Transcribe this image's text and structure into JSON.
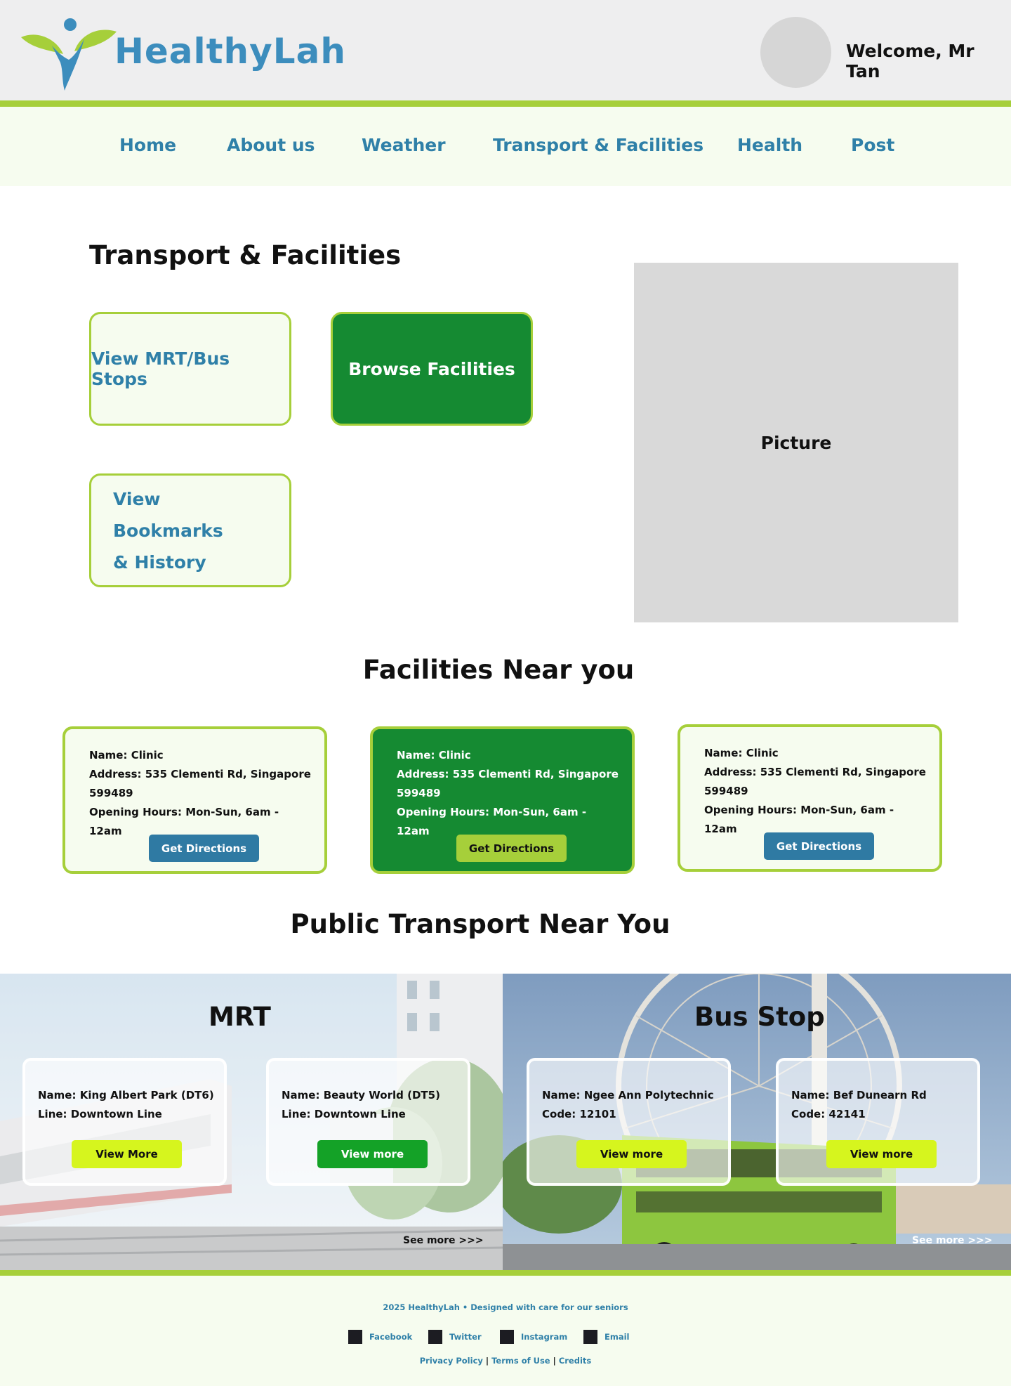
{
  "header": {
    "brand": "HealthyLah",
    "welcome": "Welcome, Mr Tan"
  },
  "nav": {
    "items": [
      {
        "label": "Home"
      },
      {
        "label": "About us"
      },
      {
        "label": "Weather"
      },
      {
        "label": "Transport & Facilities"
      },
      {
        "label": "Health"
      },
      {
        "label": "Post"
      }
    ]
  },
  "main": {
    "title": "Transport & Facilities",
    "buttons": {
      "mrt_bus": "View MRT/Bus Stops",
      "browse": "Browse Facilities",
      "bookmarks_line1": "View Bookmarks",
      "bookmarks_line2": "& History"
    },
    "picture_label": "Picture"
  },
  "facilities": {
    "title": "Facilities Near you",
    "cards": [
      {
        "name": "Name: Clinic",
        "address_line1": "Address: 535 Clementi Rd, Singapore",
        "address_line2": "599489",
        "hours": "Opening Hours: Mon-Sun, 6am - 12am",
        "button": "Get Directions"
      },
      {
        "name": "Name: Clinic",
        "address_line1": "Address: 535 Clementi Rd, Singapore",
        "address_line2": "599489",
        "hours": "Opening Hours: Mon-Sun, 6am - 12am",
        "button": "Get Directions"
      },
      {
        "name": "Name: Clinic",
        "address_line1": "Address: 535 Clementi Rd, Singapore",
        "address_line2": "599489",
        "hours": "Opening Hours: Mon-Sun, 6am - 12am",
        "button": "Get Directions"
      }
    ]
  },
  "transport": {
    "title": "Public Transport Near You",
    "mrt": {
      "title": "MRT",
      "cards": [
        {
          "name": "Name: King Albert Park (DT6)",
          "detail": "Line: Downtown Line",
          "button": "View More"
        },
        {
          "name": "Name: Beauty World (DT5)",
          "detail": "Line: Downtown Line",
          "button": "View more"
        }
      ],
      "see_more": "See more >>>"
    },
    "bus": {
      "title": "Bus Stop",
      "cards": [
        {
          "name": "Name: Ngee Ann Polytechnic",
          "detail": "Code: 12101",
          "button": "View more"
        },
        {
          "name": "Name: Bef Dunearn Rd",
          "detail": "Code: 42141",
          "button": "View more"
        }
      ],
      "see_more": "See more >>>"
    }
  },
  "footer": {
    "copyright": "2025 HealthyLah • Designed with care for our seniors",
    "social": [
      "Facebook",
      "Twitter",
      "Instagram",
      "Email"
    ],
    "legal": [
      "Privacy Policy",
      "Terms of Use",
      "Credits"
    ]
  },
  "colors": {
    "brand_blue": "#3c8dbd",
    "accent_green": "#a6cf3a",
    "dark_green": "#158a32",
    "nav_bg": "#f6fcef",
    "button_blue": "#2f7aa3",
    "lime": "#d6f51e"
  },
  "icons": {
    "logo": "person-leaf-logo",
    "social": "square-icon"
  }
}
